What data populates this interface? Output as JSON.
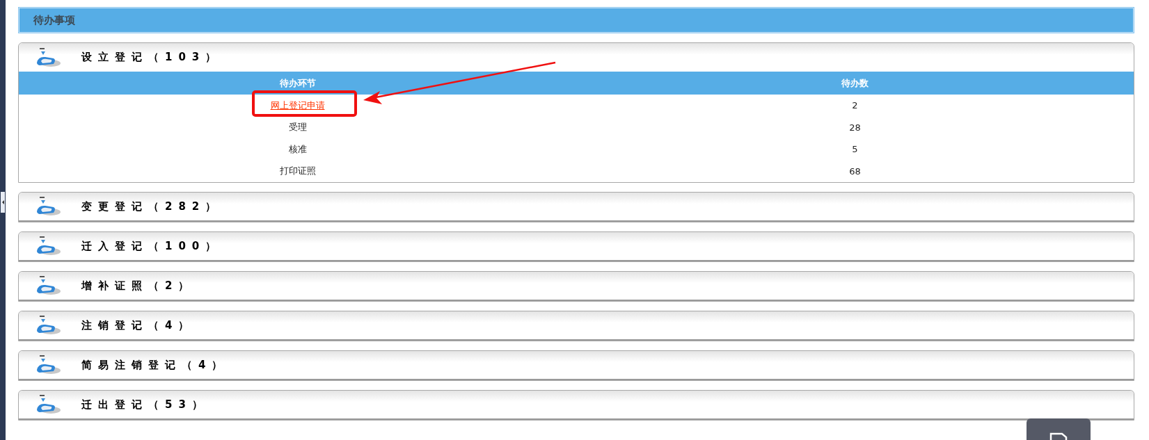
{
  "page_title": "待办事项",
  "groups": [
    {
      "title": "设立登记（103）",
      "expanded": true,
      "table": {
        "columns": [
          "待办环节",
          "待办数"
        ],
        "rows": [
          {
            "step": "网上登记申请",
            "count": "2",
            "kind": "link"
          },
          {
            "step": "受理",
            "count": "28",
            "kind": "text"
          },
          {
            "step": "核准",
            "count": "5",
            "kind": "text"
          },
          {
            "step": "打印证照",
            "count": "68",
            "kind": "text"
          }
        ]
      }
    },
    {
      "title": "变更登记（282）",
      "expanded": false
    },
    {
      "title": "迁入登记（100）",
      "expanded": false
    },
    {
      "title": "增补证照（2）",
      "expanded": false
    },
    {
      "title": "注销登记（4）",
      "expanded": false
    },
    {
      "title": "简易注销登记（4）",
      "expanded": false
    },
    {
      "title": "迁出登记（53）",
      "expanded": false
    }
  ]
}
